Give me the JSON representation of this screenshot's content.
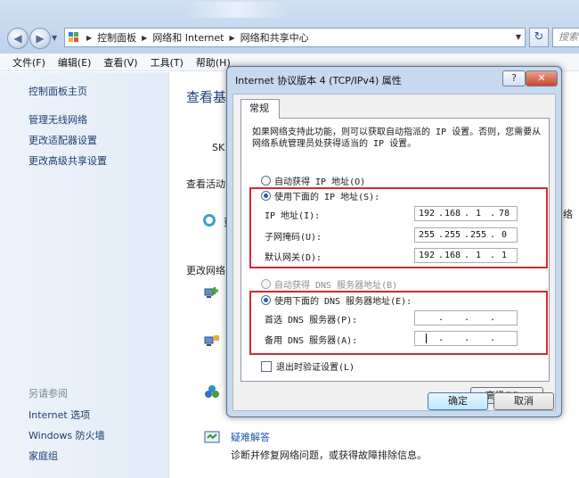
{
  "explorer": {
    "breadcrumb": [
      "控制面板",
      "网络和 Internet",
      "网络和共享中心"
    ],
    "search_placeholder": "搜索",
    "menu": [
      "文件(F)",
      "编辑(E)",
      "查看(V)",
      "工具(T)",
      "帮助(H)"
    ],
    "sidebar": {
      "home": "控制面板主页",
      "links": [
        "管理无线网络",
        "更改适配器设置",
        "更改高级共享设置"
      ],
      "see_also_header": "另请参阅",
      "see_also": [
        "Internet 选项",
        "Windows 防火墙",
        "家庭组"
      ]
    },
    "main": {
      "title": "查看基",
      "sky": "SK",
      "view_active": "查看活动",
      "active_fragment": "更",
      "change_network": "更改网络",
      "network_suffix": "络",
      "troubleshoot_link": "疑难解答",
      "troubleshoot_desc": "诊断并修复网络问题，或获得故障排除信息。"
    }
  },
  "dialog": {
    "title": "Internet 协议版本 4 (TCP/IPv4) 属性",
    "help_label": "?",
    "close_label": "✕",
    "tab_label": "常规",
    "description": "如果网络支持此功能，则可以获取自动指派的 IP 设置。否则，您需要从网络系统管理员处获得适当的 IP 设置。",
    "ip_section": {
      "auto_label": "自动获得 IP 地址(O)",
      "manual_label": "使用下面的 IP 地址(S):",
      "fields": [
        {
          "label": "IP 地址(I):",
          "octets": [
            "192",
            "168",
            "1",
            "78"
          ]
        },
        {
          "label": "子网掩码(U):",
          "octets": [
            "255",
            "255",
            "255",
            "0"
          ]
        },
        {
          "label": "默认网关(D):",
          "octets": [
            "192",
            "168",
            "1",
            "1"
          ]
        }
      ]
    },
    "dns_section": {
      "auto_label": "自动获得 DNS 服务器地址(B)",
      "manual_label": "使用下面的 DNS 服务器地址(E):",
      "fields": [
        {
          "label": "首选 DNS 服务器(P):",
          "octets": [
            "",
            "",
            "",
            ""
          ]
        },
        {
          "label": "备用 DNS 服务器(A):",
          "octets": [
            "",
            "",
            "",
            ""
          ]
        }
      ]
    },
    "validate_label": "退出时验证设置(L)",
    "advanced_label": "高级(V)...",
    "ok_label": "确定",
    "cancel_label": "取消",
    "highlight_color": "#d9282f"
  }
}
